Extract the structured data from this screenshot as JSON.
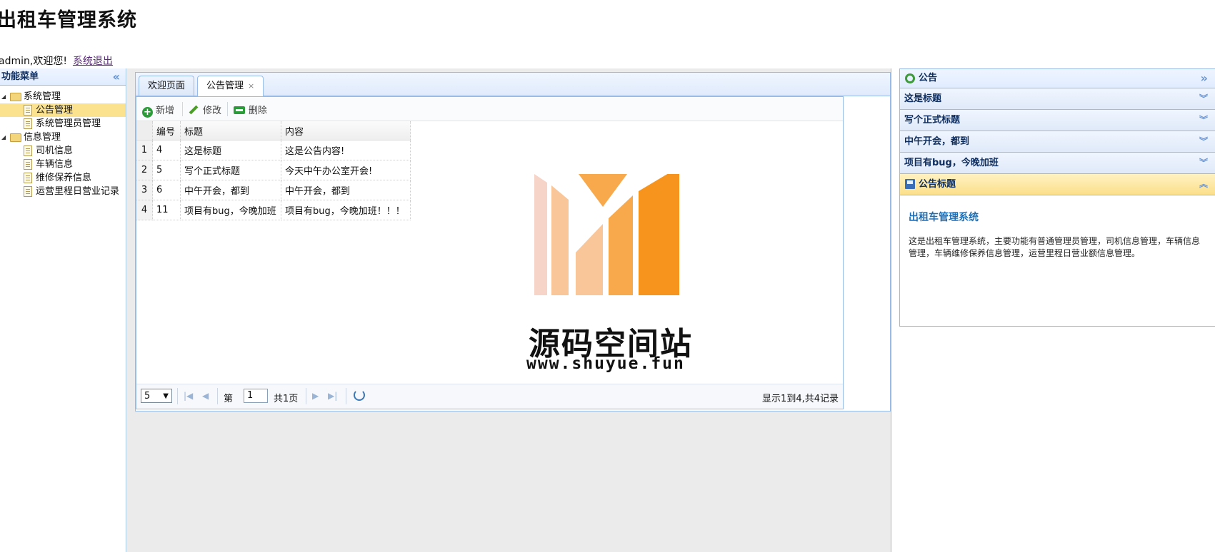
{
  "header": {
    "title": "出租车管理系统",
    "welcome": "admin,欢迎您!",
    "logout_label": "系统退出"
  },
  "left_menu": {
    "title": "功能菜单",
    "tree": [
      {
        "label": "系统管理",
        "type": "folder",
        "children": [
          {
            "label": "公告管理",
            "selected": true
          },
          {
            "label": "系统管理员管理"
          }
        ]
      },
      {
        "label": "信息管理",
        "type": "folder",
        "children": [
          {
            "label": "司机信息"
          },
          {
            "label": "车辆信息"
          },
          {
            "label": "维修保养信息"
          },
          {
            "label": "运营里程日营业记录"
          }
        ]
      }
    ]
  },
  "tabs": [
    {
      "label": "欢迎页面",
      "active": false
    },
    {
      "label": "公告管理",
      "active": true,
      "closable": true
    }
  ],
  "toolbar": {
    "add_label": "新增",
    "edit_label": "修改",
    "delete_label": "删除"
  },
  "grid": {
    "columns": [
      "编号",
      "标题",
      "内容"
    ],
    "rows": [
      {
        "rownum": "1",
        "id": "4",
        "title": "这是标题",
        "content": "这是公告内容!"
      },
      {
        "rownum": "2",
        "id": "5",
        "title": "写个正式标题",
        "content": "今天中午办公室开会!"
      },
      {
        "rownum": "3",
        "id": "6",
        "title": "中午开会，都到",
        "content": "中午开会，都到"
      },
      {
        "rownum": "4",
        "id": "11",
        "title": "项目有bug，今晚加班",
        "content": "项目有bug，今晚加班！！！"
      }
    ]
  },
  "pager": {
    "page_size": "5",
    "page_prefix": "第",
    "page_value": "1",
    "page_total": "共1页",
    "info": "显示1到4,共4记录"
  },
  "watermark": {
    "title": "源码空间站",
    "url": "www.shuyue.fun",
    "bar_colors": [
      "#f6d5c8",
      "#f9c69a",
      "#f8a94b",
      "#f7941d"
    ]
  },
  "right_panel": {
    "title": "公告",
    "items": [
      {
        "label": "这是标题"
      },
      {
        "label": "写个正式标题"
      },
      {
        "label": "中午开会，都到"
      },
      {
        "label": "项目有bug，今晚加班"
      }
    ],
    "open_item": {
      "label": "公告标题",
      "body_title": "出租车管理系统",
      "body_text": "这是出租车管理系统，主要功能有普通管理员管理，司机信息管理，车辆信息管理，车辆维修保养信息管理，运营里程日营业额信息管理。"
    }
  }
}
